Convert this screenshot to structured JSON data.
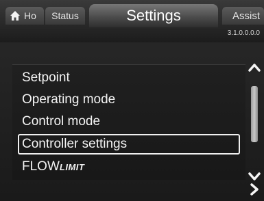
{
  "header": {
    "tabs": {
      "home": "Ho",
      "status": "Status",
      "settings": "Settings",
      "assist": "Assist"
    },
    "version": "3.1.0.0.0.0"
  },
  "menu": {
    "items": [
      {
        "label": "Setpoint"
      },
      {
        "label": "Operating mode"
      },
      {
        "label": "Control mode"
      },
      {
        "label": "Controller settings",
        "selected": true
      },
      {
        "label_main": "FLOW",
        "label_suffix": "LIMIT"
      }
    ]
  },
  "icons": {
    "home": "home-icon",
    "scroll_up": "chevron-up-icon",
    "scroll_down": "chevron-down-icon",
    "next": "chevron-right-icon"
  },
  "colors": {
    "background": "#1e1e1e",
    "text": "#f2f2f2",
    "selection_border": "#f0f0f0"
  }
}
